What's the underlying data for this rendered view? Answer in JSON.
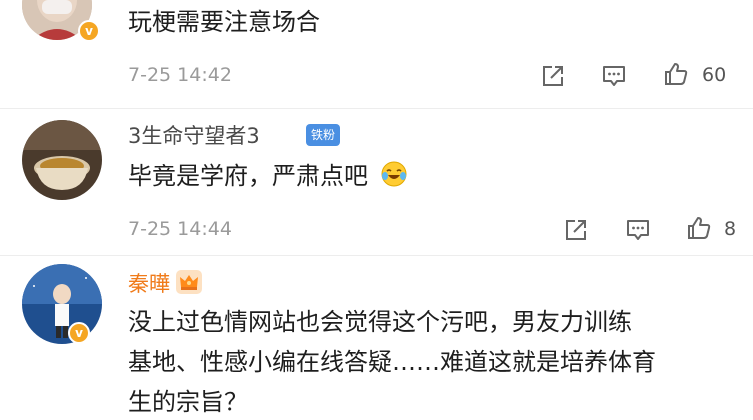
{
  "comments": [
    {
      "text": "玩梗需要注意场合",
      "time": "7-25 14:42",
      "likes": "60"
    },
    {
      "user": "3生命守望者3",
      "fan_badge": "铁粉",
      "text": "毕竟是学府，严肃点吧",
      "emoji": "laugh-cry-emoji",
      "time": "7-25 14:44",
      "likes": "8"
    },
    {
      "user": "秦曄",
      "badge": "crown-badge",
      "text_lines": [
        "没上过色情网站也会觉得这个污吧，男友力训练",
        "基地、性感小编在线答疑……难道这就是培养体育",
        "生的宗旨？"
      ]
    }
  ],
  "colors": {
    "orange_name": "#f07b1a",
    "verified": "#f5a623",
    "fan_badge": "#4a8fe2",
    "meta_gray": "#9a9a9a"
  },
  "icons": [
    "share-icon",
    "comment-icon",
    "like-icon"
  ]
}
